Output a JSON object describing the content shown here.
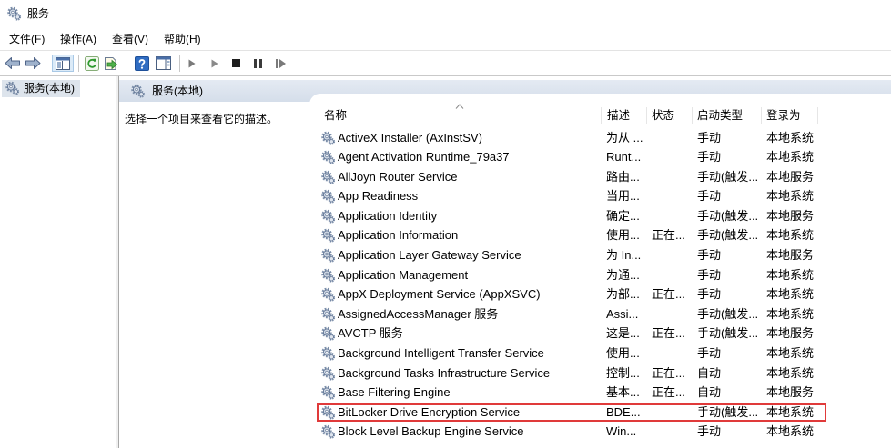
{
  "window": {
    "title": "服务",
    "icon": "services-gear-icon"
  },
  "menu": [
    {
      "label": "文件(F)"
    },
    {
      "label": "操作(A)"
    },
    {
      "label": "查看(V)"
    },
    {
      "label": "帮助(H)"
    }
  ],
  "toolbar": {
    "icons": [
      "back-arrow-icon",
      "forward-arrow-icon",
      "console-tree-icon",
      "refresh-icon",
      "export-list-icon",
      "help-icon",
      "action-pane-icon",
      "start-service-icon",
      "resume-service-icon",
      "stop-service-icon",
      "pause-service-icon",
      "restart-service-icon"
    ]
  },
  "tree": {
    "items": [
      {
        "label": "服务(本地)",
        "icon": "services-gear-icon",
        "selected": true
      }
    ]
  },
  "panel": {
    "header": "服务(本地)",
    "description": "选择一个项目来查看它的描述。"
  },
  "table": {
    "sort_icon": "sort-ascending-icon",
    "row_icon": "service-gear-icon",
    "columns": {
      "name": "名称",
      "desc": "描述",
      "status": "状态",
      "startup": "启动类型",
      "logon": "登录为"
    },
    "rows": [
      {
        "name": "ActiveX Installer (AxInstSV)",
        "desc": "为从 ...",
        "startup": "手动",
        "logon": "本地系统"
      },
      {
        "name": "Agent Activation Runtime_79a37",
        "desc": "Runt...",
        "startup": "手动",
        "logon": "本地系统"
      },
      {
        "name": "AllJoyn Router Service",
        "desc": "路由...",
        "startup": "手动(触发...",
        "logon": "本地服务"
      },
      {
        "name": "App Readiness",
        "desc": "当用...",
        "startup": "手动",
        "logon": "本地系统"
      },
      {
        "name": "Application Identity",
        "desc": "确定...",
        "startup": "手动(触发...",
        "logon": "本地服务"
      },
      {
        "name": "Application Information",
        "desc": "使用...",
        "status": "正在...",
        "startup": "手动(触发...",
        "logon": "本地系统"
      },
      {
        "name": "Application Layer Gateway Service",
        "desc": "为 In...",
        "startup": "手动",
        "logon": "本地服务"
      },
      {
        "name": "Application Management",
        "desc": "为通...",
        "startup": "手动",
        "logon": "本地系统"
      },
      {
        "name": "AppX Deployment Service (AppXSVC)",
        "desc": "为部...",
        "status": "正在...",
        "startup": "手动",
        "logon": "本地系统"
      },
      {
        "name": "AssignedAccessManager 服务",
        "desc": "Assi...",
        "startup": "手动(触发...",
        "logon": "本地系统"
      },
      {
        "name": "AVCTP 服务",
        "desc": "这是...",
        "status": "正在...",
        "startup": "手动(触发...",
        "logon": "本地服务"
      },
      {
        "name": "Background Intelligent Transfer Service",
        "desc": "使用...",
        "startup": "手动",
        "logon": "本地系统"
      },
      {
        "name": "Background Tasks Infrastructure Service",
        "desc": "控制...",
        "status": "正在...",
        "startup": "自动",
        "logon": "本地系统"
      },
      {
        "name": "Base Filtering Engine",
        "desc": "基本...",
        "status": "正在...",
        "startup": "自动",
        "logon": "本地服务"
      },
      {
        "name": "BitLocker Drive Encryption Service",
        "desc": "BDE...",
        "startup": "手动(触发...",
        "logon": "本地系统",
        "highlight": true
      },
      {
        "name": "Block Level Backup Engine Service",
        "desc": "Win...",
        "startup": "手动",
        "logon": "本地系统"
      }
    ]
  },
  "colors": {
    "highlight_box": "#e03a3a",
    "panel_header": "#d5deea",
    "tree_selection": "#dde4ec"
  }
}
